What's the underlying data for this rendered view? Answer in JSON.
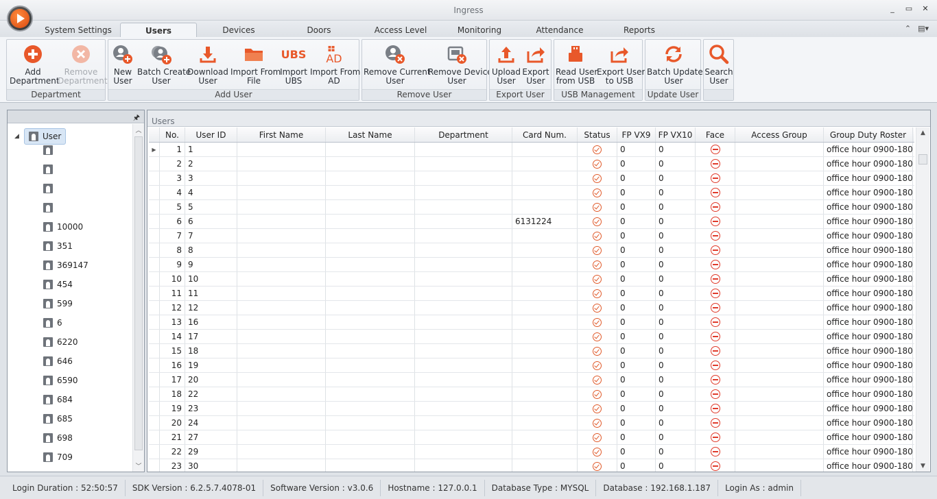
{
  "window": {
    "title": "Ingress",
    "controls": [
      "_",
      "▭",
      "✕"
    ]
  },
  "tabs": [
    {
      "label": "System Settings",
      "active": false
    },
    {
      "label": "Users",
      "active": true
    },
    {
      "label": "Devices",
      "active": false
    },
    {
      "label": "Doors",
      "active": false
    },
    {
      "label": "Access Level",
      "active": false
    },
    {
      "label": "Monitoring",
      "active": false
    },
    {
      "label": "Attendance",
      "active": false
    },
    {
      "label": "Reports",
      "active": false
    }
  ],
  "tabs_right": {
    "collapse_icon": "⌃",
    "layout_icon": "▤▾"
  },
  "ribbon": {
    "groups": [
      {
        "label": "Department",
        "buttons": [
          {
            "label": "Add\nDepartment",
            "icon": "add-circle-icon",
            "disabled": false
          },
          {
            "label": "Remove\nDepartment",
            "icon": "remove-circle-icon",
            "disabled": true
          }
        ]
      },
      {
        "label": "Add User",
        "buttons": [
          {
            "label": "New\nUser",
            "icon": "new-user-icon",
            "disabled": false
          },
          {
            "label": "Batch Create\nUser",
            "icon": "batch-create-user-icon",
            "disabled": false
          },
          {
            "label": "Download\nUser",
            "icon": "download-icon",
            "disabled": false
          },
          {
            "label": "Import From\nFile",
            "icon": "folder-icon",
            "disabled": false
          },
          {
            "label": "Import\nUBS",
            "icon": "ubs-icon",
            "icon_text": "UBS",
            "disabled": false
          },
          {
            "label": "Import From\nAD",
            "icon": "ad-icon",
            "icon_text": "AD",
            "disabled": false
          }
        ]
      },
      {
        "label": "Remove User",
        "buttons": [
          {
            "label": "Remove Current\nUser",
            "icon": "remove-user-icon",
            "disabled": false
          },
          {
            "label": "Remove Device\nUser",
            "icon": "remove-device-user-icon",
            "disabled": false
          }
        ]
      },
      {
        "label": "Export User",
        "buttons": [
          {
            "label": "Upload\nUser",
            "icon": "upload-icon",
            "disabled": false
          },
          {
            "label": "Export\nUser",
            "icon": "export-icon",
            "disabled": false
          }
        ]
      },
      {
        "label": "USB Management",
        "buttons": [
          {
            "label": "Read User\nfrom USB",
            "icon": "usb-icon",
            "disabled": false
          },
          {
            "label": "Export User\nto USB",
            "icon": "export-usb-icon",
            "disabled": false
          }
        ]
      },
      {
        "label": "Update User",
        "buttons": [
          {
            "label": "Batch Update\nUser",
            "icon": "refresh-icon",
            "disabled": false
          }
        ]
      },
      {
        "label": "",
        "buttons": [
          {
            "label": "Search\nUser",
            "icon": "search-icon",
            "disabled": false
          }
        ]
      }
    ]
  },
  "tree": {
    "root_label": "User",
    "items": [
      "",
      "",
      "",
      "",
      "10000",
      "351",
      "369147",
      "454",
      "599",
      "6",
      "6220",
      "646",
      "6590",
      "684",
      "685",
      "698",
      "709"
    ]
  },
  "users_panel": {
    "title": "Users",
    "columns": [
      "No.",
      "User ID",
      "First Name",
      "Last Name",
      "Department",
      "Card Num.",
      "Status",
      "FP VX9",
      "FP VX10",
      "Face",
      "Access Group",
      "Group Duty Roster"
    ],
    "rows": [
      {
        "no": "1",
        "user_id": "1",
        "first_name": "",
        "last_name": "",
        "department": "",
        "card": "",
        "fp9": "0",
        "fp10": "0",
        "access_group": "",
        "roster": "office hour 0900-1800"
      },
      {
        "no": "2",
        "user_id": "2",
        "first_name": "",
        "last_name": "",
        "department": "",
        "card": "",
        "fp9": "0",
        "fp10": "0",
        "access_group": "",
        "roster": "office hour 0900-1800"
      },
      {
        "no": "3",
        "user_id": "3",
        "first_name": "",
        "last_name": "",
        "department": "",
        "card": "",
        "fp9": "0",
        "fp10": "0",
        "access_group": "",
        "roster": "office hour 0900-1800"
      },
      {
        "no": "4",
        "user_id": "4",
        "first_name": "",
        "last_name": "",
        "department": "",
        "card": "",
        "fp9": "0",
        "fp10": "0",
        "access_group": "",
        "roster": "office hour 0900-1800"
      },
      {
        "no": "5",
        "user_id": "5",
        "first_name": "",
        "last_name": "",
        "department": "",
        "card": "",
        "fp9": "0",
        "fp10": "0",
        "access_group": "",
        "roster": "office hour 0900-1800"
      },
      {
        "no": "6",
        "user_id": "6",
        "first_name": "",
        "last_name": "",
        "department": "",
        "card": "6131224",
        "fp9": "0",
        "fp10": "0",
        "access_group": "",
        "roster": "office hour 0900-1800"
      },
      {
        "no": "7",
        "user_id": "7",
        "first_name": "",
        "last_name": "",
        "department": "",
        "card": "",
        "fp9": "0",
        "fp10": "0",
        "access_group": "",
        "roster": "office hour 0900-1800"
      },
      {
        "no": "8",
        "user_id": "8",
        "first_name": "",
        "last_name": "",
        "department": "",
        "card": "",
        "fp9": "0",
        "fp10": "0",
        "access_group": "",
        "roster": "office hour 0900-1800"
      },
      {
        "no": "9",
        "user_id": "9",
        "first_name": "",
        "last_name": "",
        "department": "",
        "card": "",
        "fp9": "0",
        "fp10": "0",
        "access_group": "",
        "roster": "office hour 0900-1800"
      },
      {
        "no": "10",
        "user_id": "10",
        "first_name": "",
        "last_name": "",
        "department": "",
        "card": "",
        "fp9": "0",
        "fp10": "0",
        "access_group": "",
        "roster": "office hour 0900-1800"
      },
      {
        "no": "11",
        "user_id": "11",
        "first_name": "",
        "last_name": "",
        "department": "",
        "card": "",
        "fp9": "0",
        "fp10": "0",
        "access_group": "",
        "roster": "office hour 0900-1800"
      },
      {
        "no": "12",
        "user_id": "12",
        "first_name": "",
        "last_name": "",
        "department": "",
        "card": "",
        "fp9": "0",
        "fp10": "0",
        "access_group": "",
        "roster": "office hour 0900-1800"
      },
      {
        "no": "13",
        "user_id": "16",
        "first_name": "",
        "last_name": "",
        "department": "",
        "card": "",
        "fp9": "0",
        "fp10": "0",
        "access_group": "",
        "roster": "office hour 0900-1800"
      },
      {
        "no": "14",
        "user_id": "17",
        "first_name": "",
        "last_name": "",
        "department": "",
        "card": "",
        "fp9": "0",
        "fp10": "0",
        "access_group": "",
        "roster": "office hour 0900-1800"
      },
      {
        "no": "15",
        "user_id": "18",
        "first_name": "",
        "last_name": "",
        "department": "",
        "card": "",
        "fp9": "0",
        "fp10": "0",
        "access_group": "",
        "roster": "office hour 0900-1800"
      },
      {
        "no": "16",
        "user_id": "19",
        "first_name": "",
        "last_name": "",
        "department": "",
        "card": "",
        "fp9": "0",
        "fp10": "0",
        "access_group": "",
        "roster": "office hour 0900-1800"
      },
      {
        "no": "17",
        "user_id": "20",
        "first_name": "",
        "last_name": "",
        "department": "",
        "card": "",
        "fp9": "0",
        "fp10": "0",
        "access_group": "",
        "roster": "office hour 0900-1800"
      },
      {
        "no": "18",
        "user_id": "22",
        "first_name": "",
        "last_name": "",
        "department": "",
        "card": "",
        "fp9": "0",
        "fp10": "0",
        "access_group": "",
        "roster": "office hour 0900-1800"
      },
      {
        "no": "19",
        "user_id": "23",
        "first_name": "",
        "last_name": "",
        "department": "",
        "card": "",
        "fp9": "0",
        "fp10": "0",
        "access_group": "",
        "roster": "office hour 0900-1800"
      },
      {
        "no": "20",
        "user_id": "24",
        "first_name": "",
        "last_name": "",
        "department": "",
        "card": "",
        "fp9": "0",
        "fp10": "0",
        "access_group": "",
        "roster": "office hour 0900-1800"
      },
      {
        "no": "21",
        "user_id": "27",
        "first_name": "",
        "last_name": "",
        "department": "",
        "card": "",
        "fp9": "0",
        "fp10": "0",
        "access_group": "",
        "roster": "office hour 0900-1800"
      },
      {
        "no": "22",
        "user_id": "29",
        "first_name": "",
        "last_name": "",
        "department": "",
        "card": "",
        "fp9": "0",
        "fp10": "0",
        "access_group": "",
        "roster": "office hour 0900-1800"
      },
      {
        "no": "23",
        "user_id": "30",
        "first_name": "",
        "last_name": "",
        "department": "",
        "card": "",
        "fp9": "0",
        "fp10": "0",
        "access_group": "",
        "roster": "office hour 0900-1800"
      }
    ]
  },
  "statusbar": [
    "Login Duration : 52:50:57",
    "SDK Version : 6.2.5.7.4078-01",
    "Software Version : v3.0.6",
    "Hostname : 127.0.0.1",
    "Database Type : MYSQL",
    "Database : 192.168.1.187",
    "Login As : admin"
  ],
  "colors": {
    "accent": "#e8582a",
    "status": "#e05a2a",
    "face": "#e03a2a"
  }
}
